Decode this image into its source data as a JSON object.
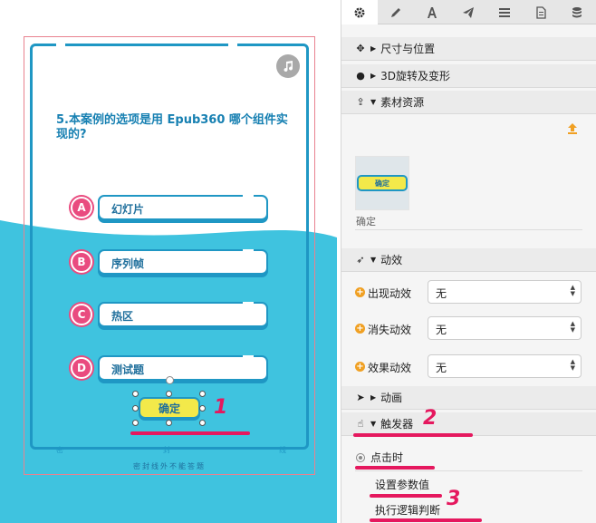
{
  "canvas": {
    "question": "5.本案例的选项是用 Epub360 哪个组件实现的?",
    "options": [
      {
        "letter": "A",
        "label": "幻灯片"
      },
      {
        "letter": "B",
        "label": "序列帧"
      },
      {
        "letter": "C",
        "label": "热区"
      },
      {
        "letter": "D",
        "label": "测试题"
      }
    ],
    "confirm_label": "确定",
    "notch_labels": [
      "密",
      "封",
      "线"
    ],
    "footer_text": "密封线外不能答题"
  },
  "annotations": [
    "1",
    "2",
    "3"
  ],
  "panel": {
    "tabs": [
      {
        "icon": "gear-icon"
      },
      {
        "icon": "pencil-icon"
      },
      {
        "icon": "font-icon"
      },
      {
        "icon": "paper-plane-icon"
      },
      {
        "icon": "list-icon"
      },
      {
        "icon": "document-icon"
      },
      {
        "icon": "database-icon"
      }
    ],
    "sections": {
      "size_position": "尺寸与位置",
      "rotate_3d": "3D旋转及变形",
      "assets": "素材资源",
      "effects": "动效",
      "animation": "动画",
      "triggers": "触发器"
    },
    "asset": {
      "thumb_text": "确定",
      "name": "确定"
    },
    "effects": [
      {
        "label": "出现动效",
        "value": "无"
      },
      {
        "label": "消失动效",
        "value": "无"
      },
      {
        "label": "效果动效",
        "value": "无"
      }
    ],
    "trigger": {
      "event": "点击时",
      "actions": [
        "设置参数值",
        "执行逻辑判断"
      ]
    }
  },
  "colors": {
    "accent_blue": "#1f97c4",
    "wave_blue": "#3fc3df",
    "pink": "#e94b7f",
    "annotation_red": "#e5185e",
    "button_yellow": "#f3e94a",
    "plus_orange": "#f0a023"
  }
}
